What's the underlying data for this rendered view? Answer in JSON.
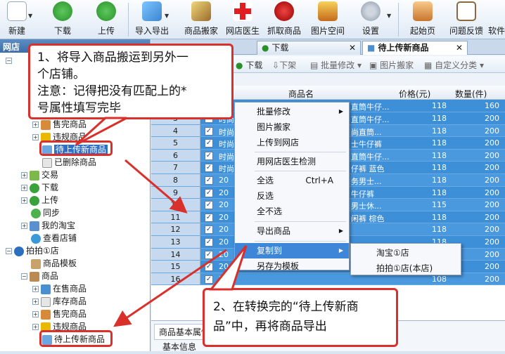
{
  "toolbar": {
    "buttons": [
      {
        "label": "新建",
        "icon": "new-file-icon"
      },
      {
        "label": "下载",
        "icon": "download-icon"
      },
      {
        "label": "上传",
        "icon": "upload-icon"
      },
      {
        "label": "导入导出",
        "icon": "import-export-icon"
      },
      {
        "label": "商品搬家",
        "icon": "move-products-icon"
      },
      {
        "label": "网店医生",
        "icon": "shop-doctor-icon"
      },
      {
        "label": "抓取商品",
        "icon": "fetch-products-icon"
      },
      {
        "label": "图片空间",
        "icon": "image-space-icon"
      },
      {
        "label": "设置",
        "icon": "gear-icon"
      },
      {
        "label": "起始页",
        "icon": "home-icon"
      },
      {
        "label": "问题反馈",
        "icon": "feedback-icon"
      },
      {
        "label": "软件",
        "icon": "software-icon"
      }
    ]
  },
  "left": {
    "header": "网店",
    "tree": [
      "售完商品",
      "违规商品",
      "待上传新商品",
      "已删除商品",
      "交易",
      "下载",
      "上传",
      "同步",
      "我的淘宝",
      "查看店铺",
      "拍拍①店",
      "商品模板",
      "商品",
      "在售商品",
      "库存商品",
      "售完商品",
      "违规商品",
      "待上传新商品"
    ]
  },
  "tabs": [
    "下载",
    "待上传新商品"
  ],
  "subtoolbar": [
    "下载",
    "下架",
    "批量修改",
    "图片搬家",
    "自定义分类"
  ],
  "grid": {
    "headers": {
      "name": "商品名",
      "price": "价格(元)",
      "qty": "数量(件)"
    },
    "rows": [
      {
        "num": "3",
        "name": "时尚",
        "name_tail": "直筒牛仔...",
        "price": "118",
        "qty": "200"
      },
      {
        "num": "4",
        "name": "时尚",
        "name_tail": "尚直筒...",
        "price": "118",
        "qty": "200"
      },
      {
        "num": "5",
        "name": "时尚",
        "name_tail": "士牛仔裤",
        "price": "118",
        "qty": "200"
      },
      {
        "num": "6",
        "name": "时尚",
        "name_tail": "直筒牛仔...",
        "price": "118",
        "qty": "200"
      },
      {
        "num": "7",
        "name": "时尚",
        "name_tail": "仔裤 蓝色",
        "price": "118",
        "qty": "200"
      },
      {
        "num": "8",
        "name": "20",
        "name_tail": "务男士...",
        "price": "118",
        "qty": "200"
      },
      {
        "num": "9",
        "name": "20",
        "name_tail": "牛仔裤",
        "price": "118",
        "qty": "200"
      },
      {
        "num": "10",
        "name": "20",
        "name_tail": "男士休...",
        "price": "115",
        "qty": "200"
      },
      {
        "num": "11",
        "name": "20",
        "name_tail": "闲裤 棕色",
        "price": "118",
        "qty": "200"
      },
      {
        "num": "12",
        "name": "20",
        "name_tail": "",
        "price": "118",
        "qty": "200"
      },
      {
        "num": "13",
        "name": "20",
        "name_tail": "",
        "price": "118",
        "qty": "200"
      },
      {
        "num": "14",
        "name": "20",
        "name_tail": "",
        "price": "118",
        "qty": "200"
      },
      {
        "num": "15",
        "name": "20",
        "name_tail": "",
        "price": "108",
        "qty": "200"
      },
      {
        "num": "16",
        "name": "20",
        "name_tail": "",
        "price": "108",
        "qty": "200"
      }
    ],
    "first_row_tail": "直筒牛仔...",
    "first_row_price": "118",
    "first_row_qty": "160"
  },
  "bottom_tabs": [
    "商品基本属性",
    "基本信息"
  ],
  "context_menu": {
    "items": [
      "批量修改",
      "图片搬家",
      "上传到网店",
      "用网店医生检测",
      "全选",
      "反选",
      "全不选",
      "导出商品",
      "复制到",
      "另存为模板"
    ],
    "select_all_shortcut": "Ctrl+A",
    "submenu": [
      "淘宝①店",
      "拍拍①店(本店)"
    ]
  },
  "callout1": {
    "line1": "1、将导入商品搬运到另外一",
    "line2": "个店铺。",
    "line3": "注意：记得把没有匹配上的*",
    "line4": "号属性填写完毕"
  },
  "callout2": {
    "line1": "2、在转换完的“待上传新商",
    "line2": "品”中，再将商品导出"
  },
  "colors": {
    "accent": "#3d86d8",
    "callout_red": "#d9302b",
    "row_blue": "#3d8fd8"
  }
}
